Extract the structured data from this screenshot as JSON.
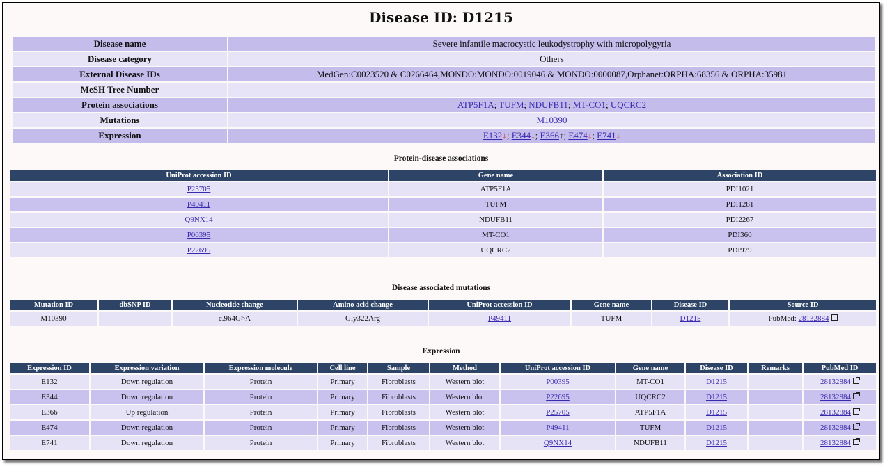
{
  "title": "Disease ID: D1215",
  "info": {
    "disease_name_label": "Disease name",
    "disease_name": "Severe infantile macrocystic leukodystrophy with micropolygyria",
    "category_label": "Disease category",
    "category": "Others",
    "ext_ids_label": "External Disease IDs",
    "ext_ids": "MedGen:C0023520 & C0266464,MONDO:MONDO:0019046 & MONDO:0000087,Orphanet:ORPHA:68356 & ORPHA:35981",
    "mesh_label": "MeSH Tree Number",
    "mesh": "",
    "protein_label": "Protein associations",
    "proteins": [
      "ATP5F1A",
      "TUFM",
      "NDUFB11",
      "MT-CO1",
      "UQCRC2"
    ],
    "mutations_label": "Mutations",
    "mutation": "M10390",
    "expression_label": "Expression",
    "expressions": [
      {
        "id": "E132",
        "arrow": "↓"
      },
      {
        "id": "E344",
        "arrow": "↓"
      },
      {
        "id": "E366",
        "arrow": "↑"
      },
      {
        "id": "E474",
        "arrow": "↓"
      },
      {
        "id": "E741",
        "arrow": "↓"
      }
    ],
    "sep": "; "
  },
  "protein_disease": {
    "title": "Protein-disease associations",
    "headers": [
      "UniProt accession ID",
      "Gene name",
      "Association ID"
    ],
    "rows": [
      [
        "P25705",
        "ATP5F1A",
        "PDI1021"
      ],
      [
        "P49411",
        "TUFM",
        "PDI1281"
      ],
      [
        "Q9NX14",
        "NDUFB11",
        "PDI2267"
      ],
      [
        "P00395",
        "MT-CO1",
        "PDI360"
      ],
      [
        "P22695",
        "UQCRC2",
        "PDI979"
      ]
    ]
  },
  "mutations": {
    "title": "Disease associated mutations",
    "headers": [
      "Mutation ID",
      "dbSNP ID",
      "Nucleotide change",
      "Amino acid change",
      "UniProt accession ID",
      "Gene name",
      "Disease ID",
      "Source ID"
    ],
    "rows": [
      {
        "mutation_id": "M10390",
        "dbsnp": "",
        "nucleotide": "c.964G>A",
        "amino": "Gly322Arg",
        "uniprot": "P49411",
        "gene": "TUFM",
        "disease": "D1215",
        "source_prefix": "PubMed: ",
        "source": "28132884"
      }
    ]
  },
  "expression": {
    "title": "Expression",
    "headers": [
      "Expression ID",
      "Expression variation",
      "Expression molecule",
      "Cell line",
      "Sample",
      "Method",
      "UniProt accession ID",
      "Gene name",
      "Disease ID",
      "Remarks",
      "PubMed ID"
    ],
    "rows": [
      {
        "id": "E132",
        "variation": "Down regulation",
        "molecule": "Protein",
        "cell": "Primary",
        "sample": "Fibroblasts",
        "method": "Western blot",
        "uniprot": "P00395",
        "gene": "MT-CO1",
        "disease": "D1215",
        "remarks": "",
        "pubmed": "28132884"
      },
      {
        "id": "E344",
        "variation": "Down regulation",
        "molecule": "Protein",
        "cell": "Primary",
        "sample": "Fibroblasts",
        "method": "Western blot",
        "uniprot": "P22695",
        "gene": "UQCRC2",
        "disease": "D1215",
        "remarks": "",
        "pubmed": "28132884"
      },
      {
        "id": "E366",
        "variation": "Up regulation",
        "molecule": "Protein",
        "cell": "Primary",
        "sample": "Fibroblasts",
        "method": "Western blot",
        "uniprot": "P25705",
        "gene": "ATP5F1A",
        "disease": "D1215",
        "remarks": "",
        "pubmed": "28132884"
      },
      {
        "id": "E474",
        "variation": "Down regulation",
        "molecule": "Protein",
        "cell": "Primary",
        "sample": "Fibroblasts",
        "method": "Western blot",
        "uniprot": "P49411",
        "gene": "TUFM",
        "disease": "D1215",
        "remarks": "",
        "pubmed": "28132884"
      },
      {
        "id": "E741",
        "variation": "Down regulation",
        "molecule": "Protein",
        "cell": "Primary",
        "sample": "Fibroblasts",
        "method": "Western blot",
        "uniprot": "Q9NX14",
        "gene": "NDUFB11",
        "disease": "D1215",
        "remarks": "",
        "pubmed": "28132884"
      }
    ]
  },
  "colors": {
    "header_bg": "#2d4466",
    "row_dark": "#c4bdec",
    "row_light": "#e7e4f7",
    "link": "#3a2ab0",
    "down_arrow": "#e01a1a"
  },
  "icons": {
    "external_link": "external-link-icon"
  }
}
